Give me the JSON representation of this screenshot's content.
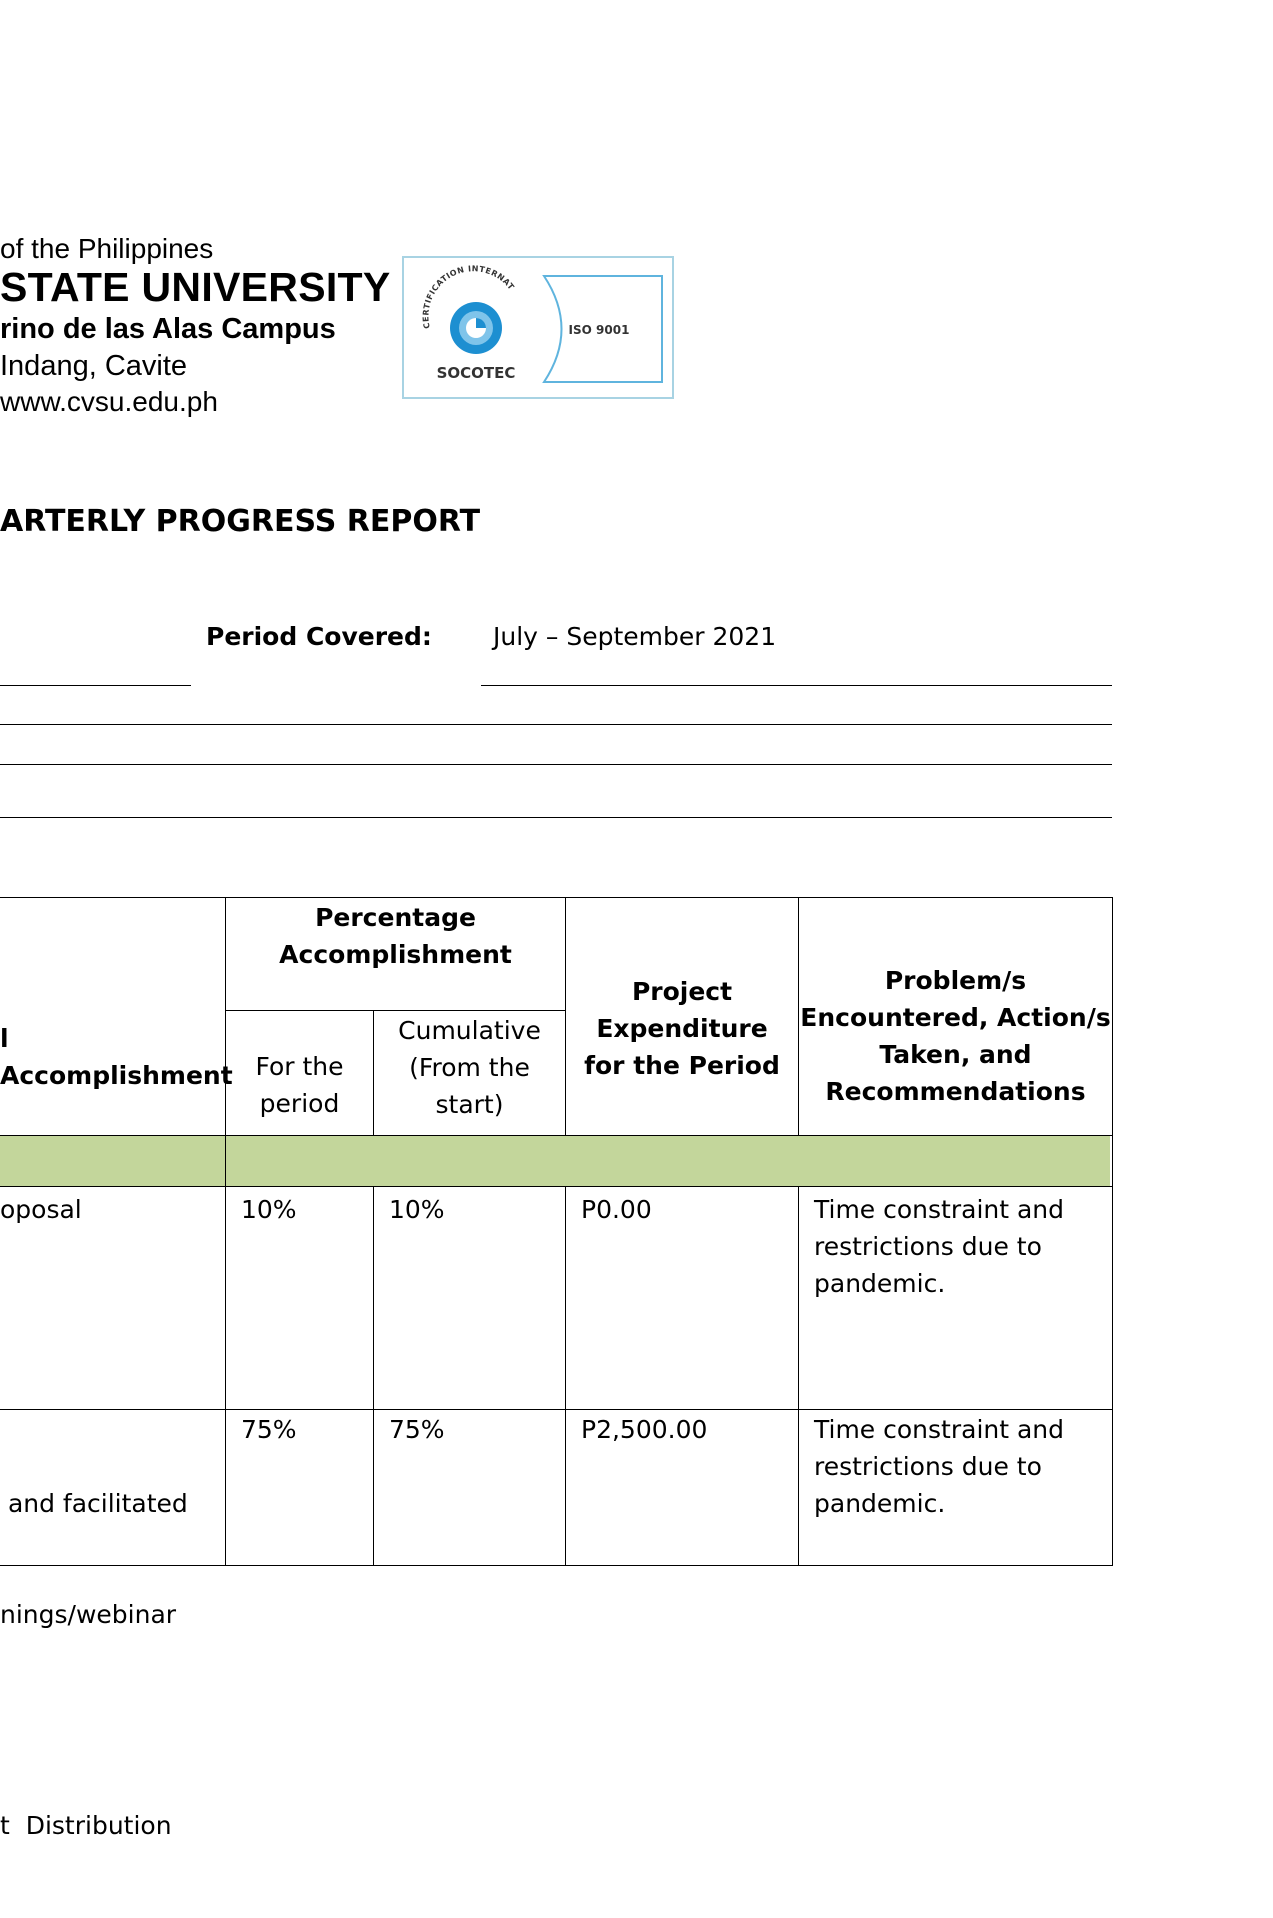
{
  "header": {
    "line1": "of the Philippines",
    "line2": "STATE UNIVERSITY",
    "line3": "rino de las Alas Campus",
    "line4": " Indang, Cavite",
    "line5": "www.cvsu.edu.ph"
  },
  "certification": {
    "arc_text": "CERTIFICATION INTERNATIONAL",
    "brand": "SOCOTEC",
    "standard": "ISO 9001",
    "logo_color": "#1d8fd1",
    "border_color": "#a8d3e3"
  },
  "report": {
    "title": "ARTERLY PROGRESS REPORT",
    "period_label": "Period Covered:",
    "period_value": "July – September 2021"
  },
  "table": {
    "headers": {
      "accomplishment": "l Accomplishment",
      "percentage": [
        "Percentage",
        "Accomplishment"
      ],
      "for_period": [
        "For the",
        "period"
      ],
      "cumulative": [
        "Cumulative",
        "(From the",
        "start)"
      ],
      "expenditure": [
        "Project",
        "Expenditure",
        "for the Period"
      ],
      "problems": [
        "Problem/s",
        "Encountered, Action/s",
        "Taken, and",
        "Recommendations"
      ]
    },
    "section_band_color": "#c3d69b",
    "rows": [
      {
        "accomplishment": [
          "oposal"
        ],
        "for_period": "10%",
        "cumulative": "10%",
        "expenditure": "P0.00",
        "problems": [
          "Time constraint and",
          "restrictions due to",
          "pandemic."
        ]
      },
      {
        "accomplishment": [
          " and facilitated",
          "nings/webinar",
          "",
          "t  Distribution"
        ],
        "for_period": "75%",
        "cumulative": "75%",
        "expenditure": "P2,500.00",
        "problems": [
          "Time constraint and",
          "restrictions due to",
          "pandemic."
        ]
      }
    ]
  }
}
